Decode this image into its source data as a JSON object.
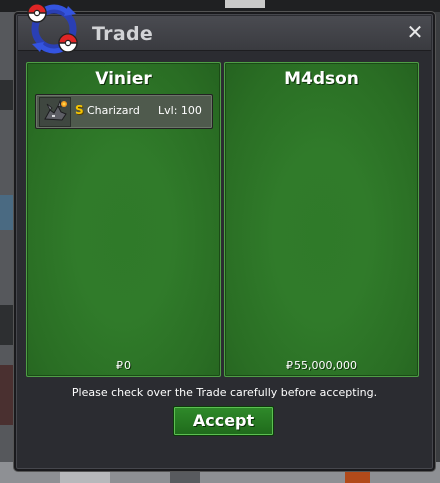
{
  "window": {
    "title": "Trade",
    "close_label": "✕"
  },
  "left_panel": {
    "player_name": "Vinier",
    "currency_symbol": "₽",
    "money": "0",
    "items": [
      {
        "shiny_marker": "S",
        "name": "Charizard",
        "level": "Lvl: 100"
      }
    ]
  },
  "right_panel": {
    "player_name": "M4dson",
    "currency_symbol": "₽",
    "money": "55,000,000",
    "items": []
  },
  "footer": {
    "notice": "Please check over the Trade carefully before accepting.",
    "accept_label": "Accept"
  },
  "colors": {
    "panel_green": "#2f7a29",
    "accept_green": "#2f8a2a",
    "shiny_gold": "#f5c400",
    "dialog_bg": "#2b2c31"
  }
}
